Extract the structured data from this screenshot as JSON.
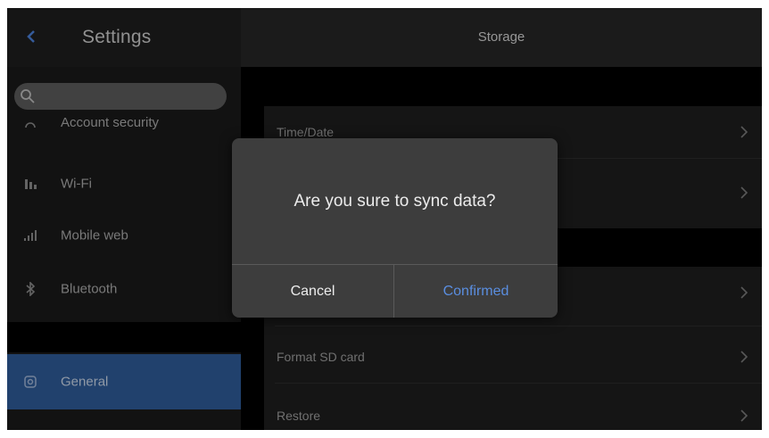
{
  "sidebar": {
    "title": "Settings",
    "back_icon": "chevron-left-icon",
    "search_icon": "search-icon",
    "items": [
      {
        "label": "Account security",
        "icon": "lock-icon"
      },
      {
        "label": "Wi-Fi",
        "icon": "wifi-icon"
      },
      {
        "label": "Mobile web",
        "icon": "signal-bars-icon"
      },
      {
        "label": "Bluetooth",
        "icon": "bluetooth-icon"
      },
      {
        "label": "General",
        "icon": "settings-icon",
        "selected": true
      }
    ]
  },
  "main": {
    "title": "Storage",
    "rows": [
      {
        "label": "Time/Date"
      },
      {
        "label": ""
      },
      {
        "label": ""
      },
      {
        "label": "Format SD card"
      },
      {
        "label": "Restore"
      }
    ]
  },
  "dialog": {
    "message": "Are you sure to sync data?",
    "cancel_label": "Cancel",
    "confirm_label": "Confirmed"
  },
  "colors": {
    "accent": "#2e5b98",
    "confirm_text": "#5a8ee0",
    "background": "#000000"
  }
}
